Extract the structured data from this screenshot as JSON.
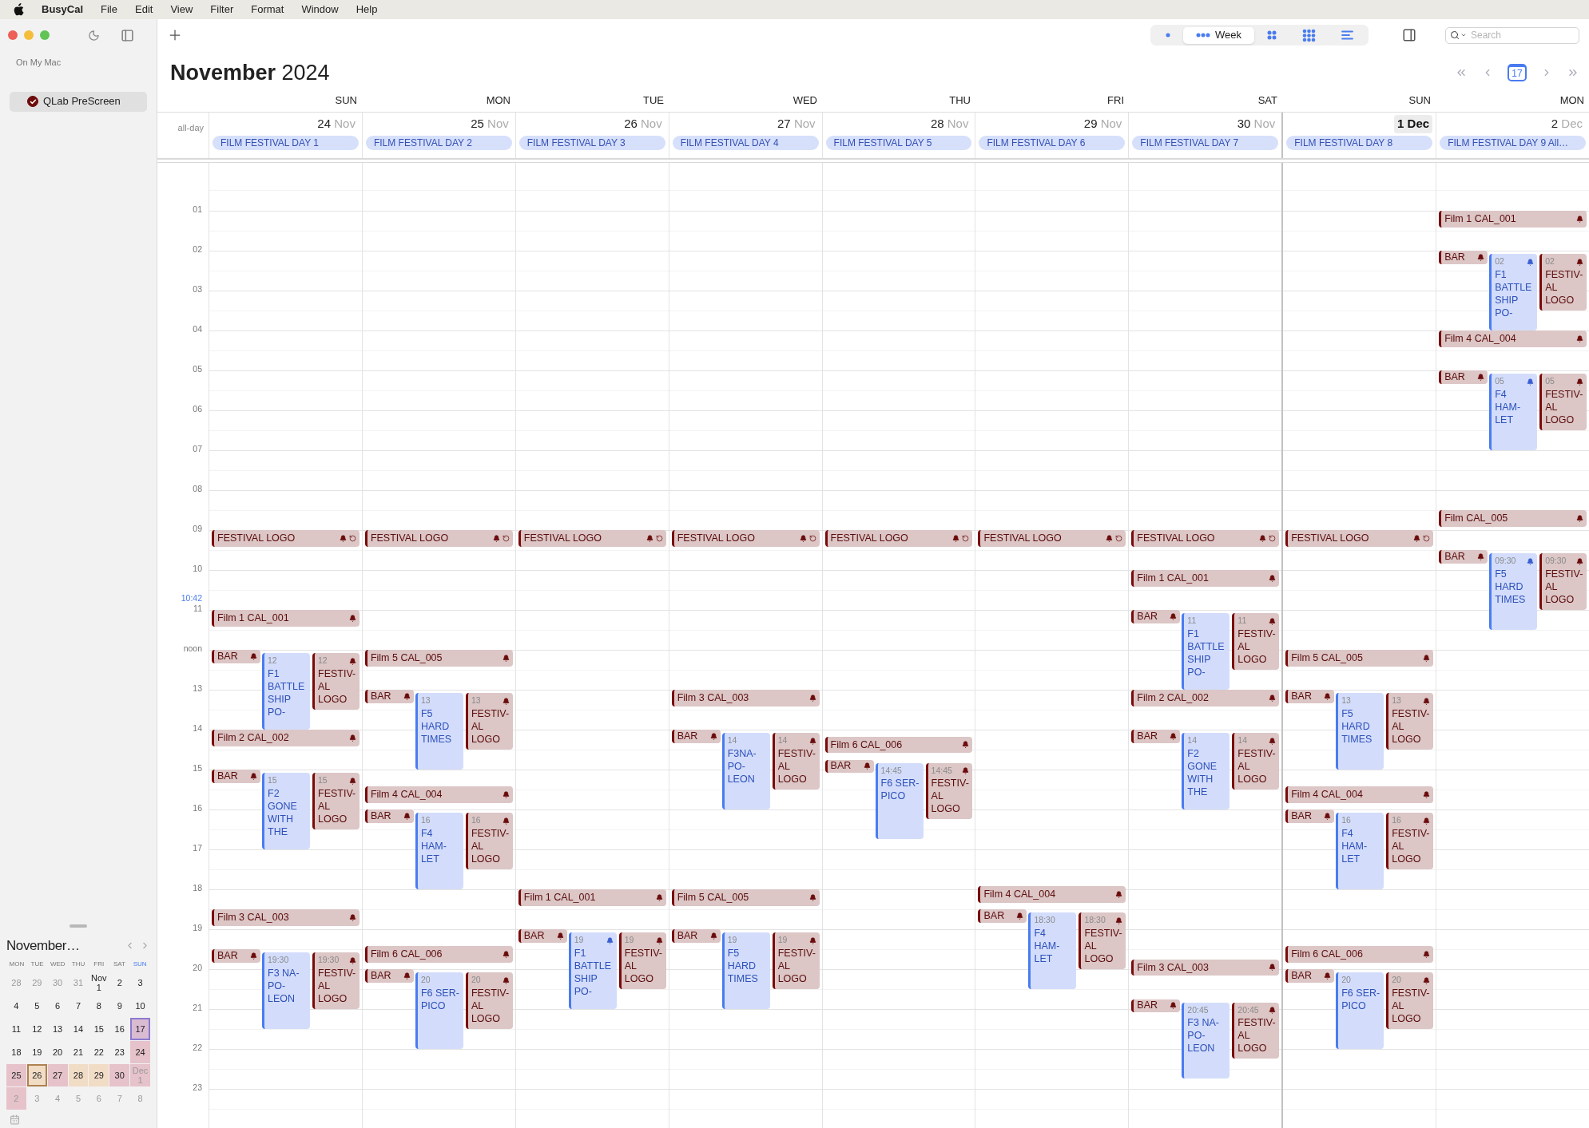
{
  "menu_bar": {
    "app": "BusyCal",
    "items": [
      "File",
      "Edit",
      "View",
      "Filter",
      "Format",
      "Window",
      "Help"
    ]
  },
  "sidebar": {
    "section": "On My Mac",
    "calendars": [
      {
        "name": "QLab PreScreen",
        "checked": true,
        "color": "#6e0b0b",
        "selected": true
      }
    ]
  },
  "mini_calendar": {
    "title": "November…",
    "weekdays": [
      {
        "label": "MON",
        "weekend": false
      },
      {
        "label": "TUE",
        "weekend": false
      },
      {
        "label": "WED",
        "weekend": false
      },
      {
        "label": "THU",
        "weekend": false
      },
      {
        "label": "FRI",
        "weekend": false
      },
      {
        "label": "SAT",
        "weekend": false
      },
      {
        "label": "SUN",
        "weekend": true
      }
    ],
    "weeks": [
      [
        {
          "label": "28",
          "muted": true
        },
        {
          "label": "29",
          "muted": true
        },
        {
          "label": "30",
          "muted": true
        },
        {
          "label": "31",
          "muted": true
        },
        {
          "label": "Nov 1",
          "muted": false
        },
        {
          "label": "2",
          "muted": false
        },
        {
          "label": "3",
          "muted": false
        }
      ],
      [
        {
          "label": "4",
          "muted": false
        },
        {
          "label": "5",
          "muted": false
        },
        {
          "label": "6",
          "muted": false
        },
        {
          "label": "7",
          "muted": false
        },
        {
          "label": "8",
          "muted": false
        },
        {
          "label": "9",
          "muted": false
        },
        {
          "label": "10",
          "muted": false
        }
      ],
      [
        {
          "label": "11",
          "muted": false
        },
        {
          "label": "12",
          "muted": false
        },
        {
          "label": "13",
          "muted": false
        },
        {
          "label": "14",
          "muted": false
        },
        {
          "label": "15",
          "muted": false
        },
        {
          "label": "16",
          "muted": false
        },
        {
          "label": "17",
          "muted": false,
          "color": "#d9bbd2",
          "today": true
        }
      ],
      [
        {
          "label": "18",
          "muted": false
        },
        {
          "label": "19",
          "muted": false
        },
        {
          "label": "20",
          "muted": false
        },
        {
          "label": "21",
          "muted": false
        },
        {
          "label": "22",
          "muted": false
        },
        {
          "label": "23",
          "muted": false
        },
        {
          "label": "24",
          "muted": false,
          "color": "#e6c2ca"
        }
      ],
      [
        {
          "label": "25",
          "muted": false,
          "color": "#e6c2ca"
        },
        {
          "label": "26",
          "muted": false,
          "color": "#f1dcc6",
          "selected": true
        },
        {
          "label": "27",
          "muted": false,
          "color": "#e6c2ca"
        },
        {
          "label": "28",
          "muted": false,
          "color": "#f1dcc6"
        },
        {
          "label": "29",
          "muted": false,
          "color": "#f1dcc6"
        },
        {
          "label": "30",
          "muted": false,
          "color": "#e6c2ca"
        },
        {
          "label": "Dec 1",
          "muted": true,
          "color": "#e6c2ca"
        }
      ],
      [
        {
          "label": "2",
          "muted": true,
          "color": "#e6c2ca"
        },
        {
          "label": "3",
          "muted": true
        },
        {
          "label": "4",
          "muted": true
        },
        {
          "label": "5",
          "muted": true
        },
        {
          "label": "6",
          "muted": true
        },
        {
          "label": "7",
          "muted": true
        },
        {
          "label": "8",
          "muted": true
        }
      ]
    ]
  },
  "toolbar": {
    "views": [
      {
        "kind": "day",
        "selected": false
      },
      {
        "kind": "week",
        "label": "Week",
        "selected": true
      },
      {
        "kind": "month",
        "selected": false
      },
      {
        "kind": "year",
        "selected": false
      },
      {
        "kind": "list",
        "selected": false
      }
    ],
    "search": {
      "placeholder": "Search"
    }
  },
  "header": {
    "month": "November",
    "year": "2024",
    "today_button": "17"
  },
  "all_day_label": "all-day",
  "hours": [
    "01",
    "02",
    "03",
    "04",
    "05",
    "06",
    "07",
    "08",
    "09",
    "10",
    "11",
    "noon",
    "13",
    "14",
    "15",
    "16",
    "17",
    "18",
    "19",
    "20",
    "21",
    "22",
    "23"
  ],
  "current_time": {
    "label": "10:42"
  },
  "days": [
    {
      "weekday": "SUN",
      "day": "24",
      "month": "Nov",
      "first_of_month": false,
      "all_day": "FILM FESTIVAL DAY 1",
      "items": [
        {
          "kind": "festival",
          "title": "FESTIVAL LOGO",
          "alarm": true,
          "repeat": true
        },
        {
          "kind": "showing",
          "heading": {
            "title": "Film 1 CAL_001",
            "alarm": true
          },
          "bar": {
            "title": "BAR",
            "alarm": true
          },
          "film": {
            "time": "12",
            "lines": [
              "F1",
              "BATTLE",
              "SHIP",
              "PO-"
            ],
            "alarm": false
          },
          "logo": {
            "time": "12",
            "lines": [
              "FESTIV-",
              "AL",
              "LOGO"
            ],
            "alarm": true
          }
        },
        {
          "kind": "showing",
          "heading": {
            "title": "Film 2 CAL_002",
            "alarm": true
          },
          "bar": {
            "title": "BAR",
            "alarm": true
          },
          "film": {
            "time": "15",
            "lines": [
              "F2",
              "GONE",
              "WITH",
              "THE"
            ],
            "alarm": false
          },
          "logo": {
            "time": "15",
            "lines": [
              "FESTIV-",
              "AL",
              "LOGO"
            ],
            "alarm": true
          }
        },
        {
          "kind": "showing",
          "heading": {
            "title": "Film 3 CAL_003",
            "alarm": true
          },
          "bar": {
            "title": "BAR",
            "alarm": true
          },
          "film": {
            "time": "19:30",
            "lines": [
              "F3 NA-",
              "PO-",
              "LEON"
            ],
            "alarm": false
          },
          "logo": {
            "time": "19:30",
            "lines": [
              "FESTIV-",
              "AL",
              "LOGO"
            ],
            "alarm": true
          }
        }
      ]
    },
    {
      "weekday": "MON",
      "day": "25",
      "month": "Nov",
      "first_of_month": false,
      "all_day": "FILM FESTIVAL DAY 2",
      "items": [
        {
          "kind": "festival",
          "title": "FESTIVAL LOGO",
          "alarm": true,
          "repeat": true
        },
        {
          "kind": "showing",
          "heading": {
            "title": "Film 5 CAL_005",
            "alarm": true
          },
          "bar": {
            "title": "BAR",
            "alarm": true
          },
          "film": {
            "time": "13",
            "lines": [
              "F5",
              "HARD",
              "TIMES"
            ],
            "alarm": false
          },
          "logo": {
            "time": "13",
            "lines": [
              "FESTIV-",
              "AL",
              "LOGO"
            ],
            "alarm": true
          }
        },
        {
          "kind": "close_showing",
          "heading": {
            "title": "Film 4 CAL_004",
            "alarm": true
          },
          "bar": {
            "title": "BAR",
            "alarm": true
          },
          "film": {
            "time": "16",
            "lines": [
              "F4",
              "HAM-",
              "LET"
            ],
            "alarm": false
          },
          "logo": {
            "time": "16",
            "lines": [
              "FESTIV-",
              "AL",
              "LOGO"
            ],
            "alarm": true
          }
        },
        {
          "kind": "close_showing",
          "heading": {
            "title": "Film 6 CAL_006",
            "alarm": true
          },
          "bar": {
            "title": "BAR",
            "alarm": true
          },
          "film": {
            "time": "20",
            "lines": [
              "F6 SER-",
              "PICO"
            ],
            "alarm": false
          },
          "logo": {
            "time": "20",
            "lines": [
              "FESTIV-",
              "AL",
              "LOGO"
            ],
            "alarm": true
          }
        }
      ]
    },
    {
      "weekday": "TUE",
      "day": "26",
      "month": "Nov",
      "first_of_month": false,
      "all_day": "FILM FESTIVAL DAY 3",
      "items": [
        {
          "kind": "festival",
          "title": "FESTIVAL LOGO",
          "alarm": true,
          "repeat": true
        },
        {
          "kind": "showing",
          "heading": {
            "title": "Film 1 CAL_001",
            "alarm": true
          },
          "bar": {
            "title": "BAR",
            "alarm": true
          },
          "film": {
            "time": "19",
            "lines": [
              "F1",
              "BATTLE",
              "SHIP",
              "PO-"
            ],
            "alarm": true
          },
          "logo": {
            "time": "19",
            "lines": [
              "FESTIV-",
              "AL",
              "LOGO"
            ],
            "alarm": true
          }
        }
      ]
    },
    {
      "weekday": "WED",
      "day": "27",
      "month": "Nov",
      "first_of_month": false,
      "all_day": "FILM FESTIVAL DAY 4",
      "items": [
        {
          "kind": "festival",
          "title": "FESTIVAL LOGO",
          "alarm": true,
          "repeat": true
        },
        {
          "kind": "showing",
          "heading": {
            "title": "Film 3 CAL_003",
            "alarm": true
          },
          "bar": {
            "title": "BAR",
            "alarm": true
          },
          "film": {
            "time": "14",
            "lines": [
              "F3NA-",
              "PO-",
              "LEON"
            ],
            "alarm": false
          },
          "logo": {
            "time": "14",
            "lines": [
              "FESTIV-",
              "AL",
              "LOGO"
            ],
            "alarm": true
          }
        },
        {
          "kind": "showing",
          "heading": {
            "title": "Film 5 CAL_005",
            "alarm": true
          },
          "bar": {
            "title": "BAR",
            "alarm": true
          },
          "film": {
            "time": "19",
            "lines": [
              "F5",
              "HARD",
              "TIMES"
            ],
            "alarm": false
          },
          "logo": {
            "time": "19",
            "lines": [
              "FESTIV-",
              "AL",
              "LOGO"
            ],
            "alarm": true
          }
        }
      ]
    },
    {
      "weekday": "THU",
      "day": "28",
      "month": "Nov",
      "first_of_month": false,
      "all_day": "FILM FESTIVAL DAY 5",
      "items": [
        {
          "kind": "festival",
          "title": "FESTIVAL LOGO",
          "alarm": true,
          "repeat": true
        },
        {
          "kind": "close_showing",
          "heading": {
            "title": "Film 6 CAL_006",
            "alarm": true
          },
          "bar": {
            "title": "BAR",
            "alarm": true
          },
          "film": {
            "time": "14:45",
            "lines": [
              "F6 SER-",
              "PICO"
            ],
            "alarm": false
          },
          "logo": {
            "time": "14:45",
            "lines": [
              "FESTIV-",
              "AL",
              "LOGO"
            ],
            "alarm": true
          }
        }
      ]
    },
    {
      "weekday": "FRI",
      "day": "29",
      "month": "Nov",
      "first_of_month": false,
      "all_day": "FILM FESTIVAL DAY 6",
      "items": [
        {
          "kind": "festival",
          "title": "FESTIVAL LOGO",
          "alarm": true,
          "repeat": true
        },
        {
          "kind": "close_showing",
          "heading": {
            "title": "Film 4 CAL_004",
            "alarm": true
          },
          "bar": {
            "title": "BAR",
            "alarm": true
          },
          "film": {
            "time": "18:30",
            "lines": [
              "F4",
              "HAM-",
              "LET"
            ],
            "alarm": false
          },
          "logo": {
            "time": "18:30",
            "lines": [
              "FESTIV-",
              "AL",
              "LOGO"
            ],
            "alarm": true
          }
        }
      ]
    },
    {
      "weekday": "SAT",
      "day": "30",
      "month": "Nov",
      "first_of_month": false,
      "all_day": "FILM FESTIVAL DAY 7",
      "items": [
        {
          "kind": "festival",
          "title": "FESTIVAL LOGO",
          "alarm": true,
          "repeat": true
        },
        {
          "kind": "showing",
          "heading": {
            "title": "Film 1 CAL_001",
            "alarm": true
          },
          "bar": {
            "title": "BAR",
            "alarm": true
          },
          "film": {
            "time": "11",
            "lines": [
              "F1",
              "BATTLE",
              "SHIP",
              "PO-"
            ],
            "alarm": false
          },
          "logo": {
            "time": "11",
            "lines": [
              "FESTIV-",
              "AL",
              "LOGO"
            ],
            "alarm": true
          }
        },
        {
          "kind": "showing",
          "heading": {
            "title": "Film 2 CAL_002",
            "alarm": true
          },
          "bar": {
            "title": "BAR",
            "alarm": true
          },
          "film": {
            "time": "14",
            "lines": [
              "F2",
              "GONE",
              "WITH",
              "THE"
            ],
            "alarm": false
          },
          "logo": {
            "time": "14",
            "lines": [
              "FESTIV-",
              "AL",
              "LOGO"
            ],
            "alarm": true
          }
        },
        {
          "kind": "showing",
          "heading": {
            "title": "Film 3 CAL_003",
            "alarm": true
          },
          "bar": {
            "title": "BAR",
            "alarm": true
          },
          "film": {
            "time": "20:45",
            "lines": [
              "F3 NA-",
              "PO-",
              "LEON"
            ],
            "alarm": false
          },
          "logo": {
            "time": "20:45",
            "lines": [
              "FESTIV-",
              "AL",
              "LOGO"
            ],
            "alarm": true
          }
        }
      ]
    },
    {
      "weekday": "SUN",
      "day": "1",
      "month": "Dec",
      "first_of_month": true,
      "all_day": "FILM FESTIVAL DAY 8",
      "items": [
        {
          "kind": "festival",
          "title": "FESTIVAL LOGO",
          "alarm": true,
          "repeat": true
        },
        {
          "kind": "showing",
          "heading": {
            "title": "Film 5 CAL_005",
            "alarm": true
          },
          "bar": {
            "title": "BAR",
            "alarm": true
          },
          "film": {
            "time": "13",
            "lines": [
              "F5",
              "HARD",
              "TIMES"
            ],
            "alarm": false
          },
          "logo": {
            "time": "13",
            "lines": [
              "FESTIV-",
              "AL",
              "LOGO"
            ],
            "alarm": true
          }
        },
        {
          "kind": "close_showing",
          "heading": {
            "title": "Film 4 CAL_004",
            "alarm": true
          },
          "bar": {
            "title": "BAR",
            "alarm": true
          },
          "film": {
            "time": "16",
            "lines": [
              "F4",
              "HAM-",
              "LET"
            ],
            "alarm": false
          },
          "logo": {
            "time": "16",
            "lines": [
              "FESTIV-",
              "AL",
              "LOGO"
            ],
            "alarm": true
          }
        },
        {
          "kind": "close_showing",
          "heading": {
            "title": "Film 6 CAL_006",
            "alarm": true
          },
          "bar": {
            "title": "BAR",
            "alarm": true
          },
          "film": {
            "time": "20",
            "lines": [
              "F6 SER-",
              "PICO"
            ],
            "alarm": false
          },
          "logo": {
            "time": "20",
            "lines": [
              "FESTIV-",
              "AL",
              "LOGO"
            ],
            "alarm": true
          }
        }
      ]
    },
    {
      "weekday": "MON",
      "day": "2",
      "month": "Dec",
      "first_of_month": false,
      "all_day": "FILM FESTIVAL DAY 9 All…",
      "items": [
        {
          "kind": "showing",
          "heading": {
            "title": "Film 1 CAL_001",
            "alarm": true
          },
          "bar": {
            "title": "BAR",
            "alarm": true
          },
          "film": {
            "time": "02",
            "lines": [
              "F1",
              "BATTLE",
              "SHIP",
              "PO-"
            ],
            "alarm": true
          },
          "logo": {
            "time": "02",
            "lines": [
              "FESTIV-",
              "AL",
              "LOGO"
            ],
            "alarm": true
          }
        },
        {
          "kind": "showing",
          "heading": {
            "title": "Film 4 CAL_004",
            "alarm": true
          },
          "bar": {
            "title": "BAR",
            "alarm": true
          },
          "film": {
            "time": "05",
            "lines": [
              "F4",
              "HAM-",
              "LET"
            ],
            "alarm": true
          },
          "logo": {
            "time": "05",
            "lines": [
              "FESTIV-",
              "AL",
              "LOGO"
            ],
            "alarm": true
          }
        },
        {
          "kind": "showing",
          "heading": {
            "title": "Film  CAL_005",
            "alarm": true
          },
          "bar": {
            "title": "BAR",
            "alarm": true
          },
          "film": {
            "time": "09:30",
            "lines": [
              "F5",
              "HARD",
              "TIMES"
            ],
            "alarm": true
          },
          "logo": {
            "time": "09:30",
            "lines": [
              "FESTIV-",
              "AL",
              "LOGO"
            ],
            "alarm": true
          }
        }
      ]
    }
  ]
}
